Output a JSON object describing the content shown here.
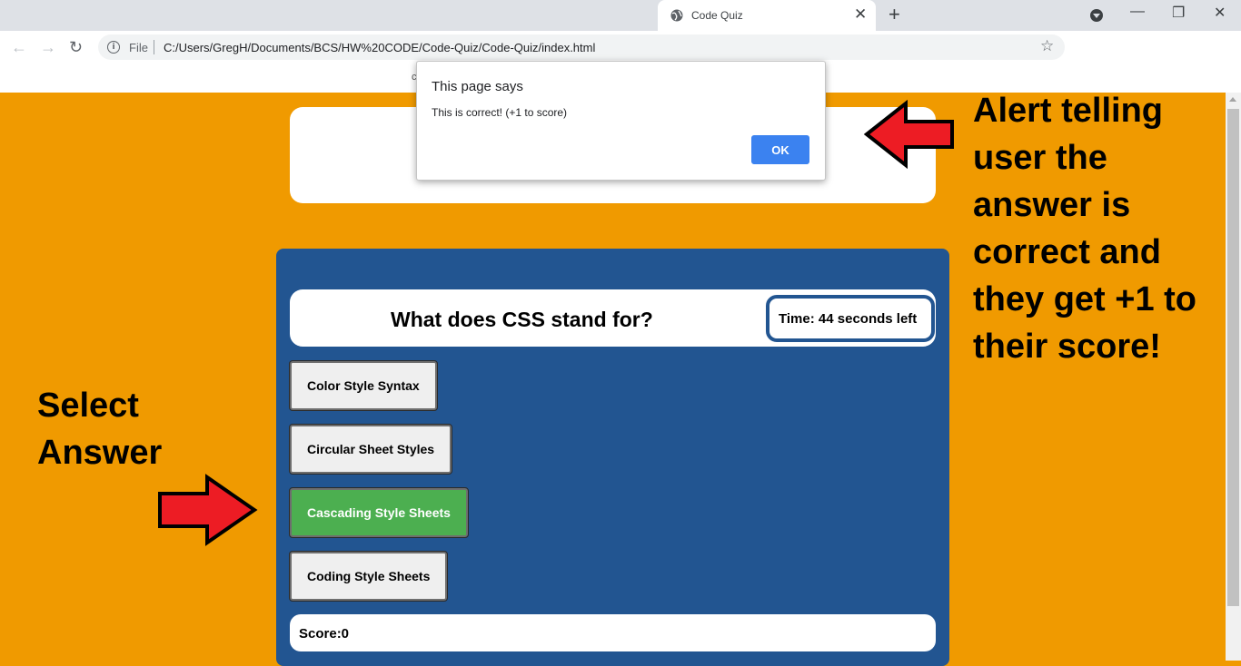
{
  "browser": {
    "tab": {
      "title": "Code Quiz",
      "close_symbol": "✕"
    },
    "new_tab_symbol": "+",
    "window_controls": {
      "minimize": "—",
      "restore": "❐",
      "close": "✕"
    },
    "nav": {
      "back": "←",
      "forward": "→",
      "reload": "↻"
    },
    "address": {
      "info_symbol": "i",
      "scheme_label": "File",
      "url": "C:/Users/GregH/Documents/BCS/HW%20CODE/Code-Quiz/Code-Quiz/index.html",
      "bookmark_symbol": "☆"
    }
  },
  "alert": {
    "title": "This page says",
    "message": "This is correct! (+1 to score)",
    "ok_label": "OK",
    "peek_char": "c"
  },
  "quiz": {
    "question": "What does CSS stand for?",
    "timer": "Time: 44 seconds left",
    "answers": [
      "Color Style Syntax",
      "Circular Sheet Styles",
      "Cascading Style Sheets",
      "Coding Style Sheets"
    ],
    "selected_answer_index": 2,
    "score": "Score:0"
  },
  "annotations": {
    "right_lines": [
      "Alert telling",
      "user the",
      "answer is",
      "correct and",
      "they get +1 to",
      "their score!"
    ],
    "left_lines": [
      "Select",
      "Answer"
    ],
    "arrow_color": "#ed1c24"
  },
  "colors": {
    "page_background": "#f09a00",
    "quiz_panel": "#225591",
    "correct_answer": "#4caf50",
    "ok_button": "#3b82f0"
  }
}
